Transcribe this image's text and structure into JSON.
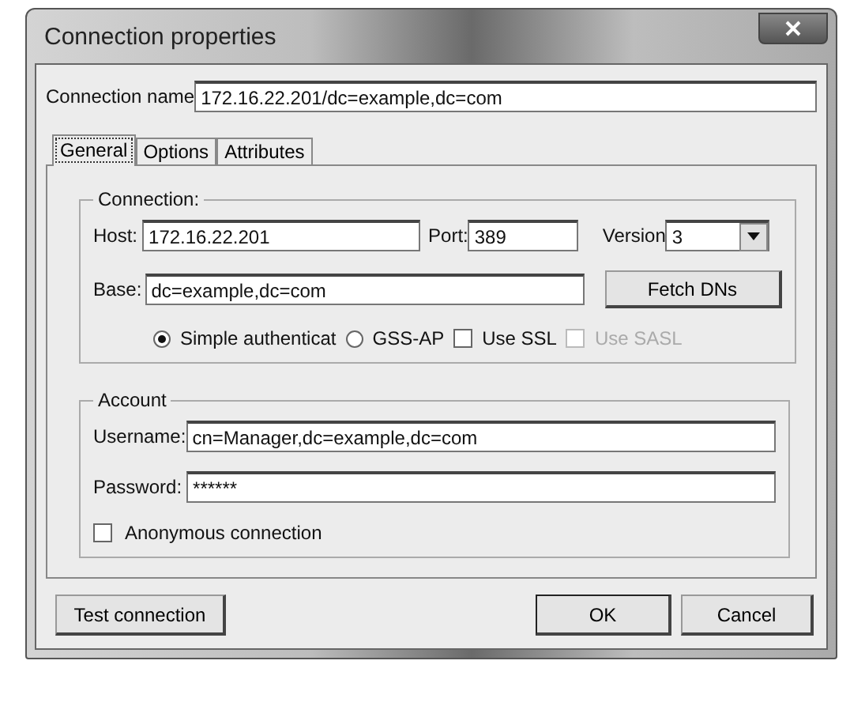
{
  "window": {
    "title": "Connection properties"
  },
  "connection_name": {
    "label": "Connection name",
    "value": "172.16.22.201/dc=example,dc=com"
  },
  "tabs": [
    {
      "label": "General",
      "selected": true
    },
    {
      "label": "Options",
      "selected": false
    },
    {
      "label": "Attributes",
      "selected": false
    }
  ],
  "connection_group": {
    "title": "Connection:",
    "host": {
      "label": "Host:",
      "value": "172.16.22.201"
    },
    "port": {
      "label": "Port:",
      "value": "389"
    },
    "version": {
      "label": "Version",
      "value": "3"
    },
    "base": {
      "label": "Base:",
      "value": "dc=example,dc=com"
    },
    "fetch_button": "Fetch DNs",
    "auth_options": [
      {
        "kind": "radio",
        "label": "Simple authenticat",
        "selected": true,
        "disabled": false
      },
      {
        "kind": "radio",
        "label": "GSS-AP",
        "selected": false,
        "disabled": false
      },
      {
        "kind": "checkbox",
        "label": "Use SSL",
        "checked": false,
        "disabled": false
      },
      {
        "kind": "checkbox",
        "label": "Use SASL",
        "checked": false,
        "disabled": true
      }
    ]
  },
  "account_group": {
    "title": "Account",
    "username": {
      "label": "Username:",
      "value": "cn=Manager,dc=example,dc=com"
    },
    "password": {
      "label": "Password:",
      "value": "******"
    },
    "anonymous": {
      "label": "Anonymous connection",
      "checked": false
    }
  },
  "test_button": "Test connection",
  "dialog_buttons": [
    {
      "label": "OK",
      "default": true
    },
    {
      "label": "Cancel",
      "default": false
    }
  ]
}
